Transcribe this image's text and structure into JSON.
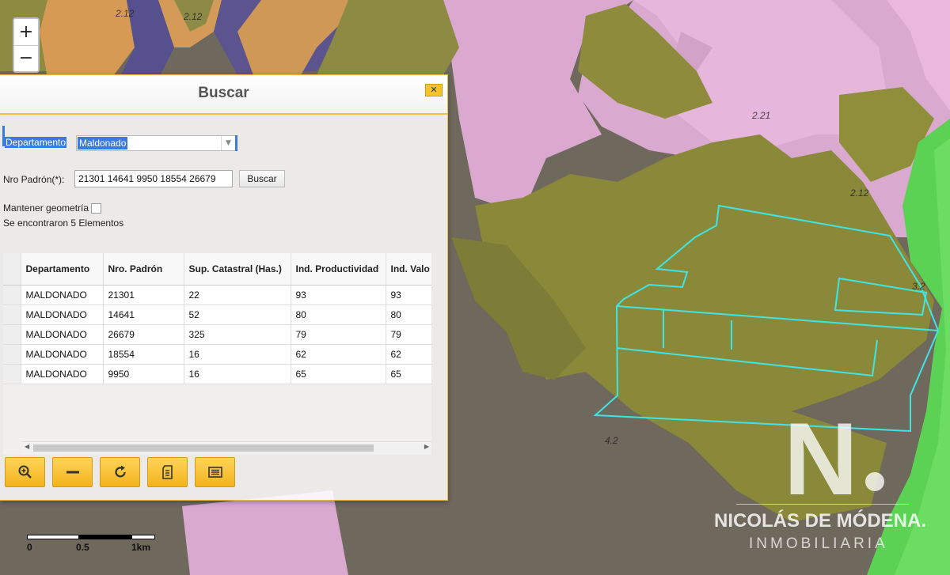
{
  "map": {
    "labels": [
      "2.12",
      "2.12",
      "2.21",
      "2.12",
      "3.2",
      "4.2"
    ],
    "zoom_in": "+",
    "zoom_out": "−",
    "scale": {
      "labels": [
        "0",
        "0.5",
        "1km"
      ]
    },
    "colors": {
      "pink": "#e7b7dd",
      "olive": "#8f8e3b",
      "dark": "#665f55",
      "parcel": "#40e6e6",
      "green": "#5fd955"
    }
  },
  "dialog": {
    "title": "Buscar",
    "close_icon": "close-icon",
    "departamento_label": "Departamento",
    "departamento_value": "Maldonado",
    "padron_label": "Nro Padrón(*):",
    "padron_value": "21301 14641 9950 18554 26679",
    "buscar_button": "Buscar",
    "mantener_label": "Mantener geometría",
    "found_text": "Se encontraron 5 Elementos",
    "table": {
      "columns": [
        "Departamento",
        "Nro. Padrón",
        "Sup. Catastral (Has.)",
        "Ind. Productividad",
        "Ind. Valo"
      ],
      "rows": [
        [
          "MALDONADO",
          "21301",
          "22",
          "93",
          "93"
        ],
        [
          "MALDONADO",
          "14641",
          "52",
          "80",
          "80"
        ],
        [
          "MALDONADO",
          "26679",
          "325",
          "79",
          "79"
        ],
        [
          "MALDONADO",
          "18554",
          "16",
          "62",
          "62"
        ],
        [
          "MALDONADO",
          "9950",
          "16",
          "65",
          "65"
        ]
      ]
    },
    "tools": [
      "zoom-in-icon",
      "minus-icon",
      "refresh-icon",
      "document-icon",
      "list-icon"
    ]
  },
  "watermark": {
    "letter": "N",
    "name": "NICOLÁS DE MÓDENA.",
    "subtitle": "INMOBILIARIA"
  }
}
